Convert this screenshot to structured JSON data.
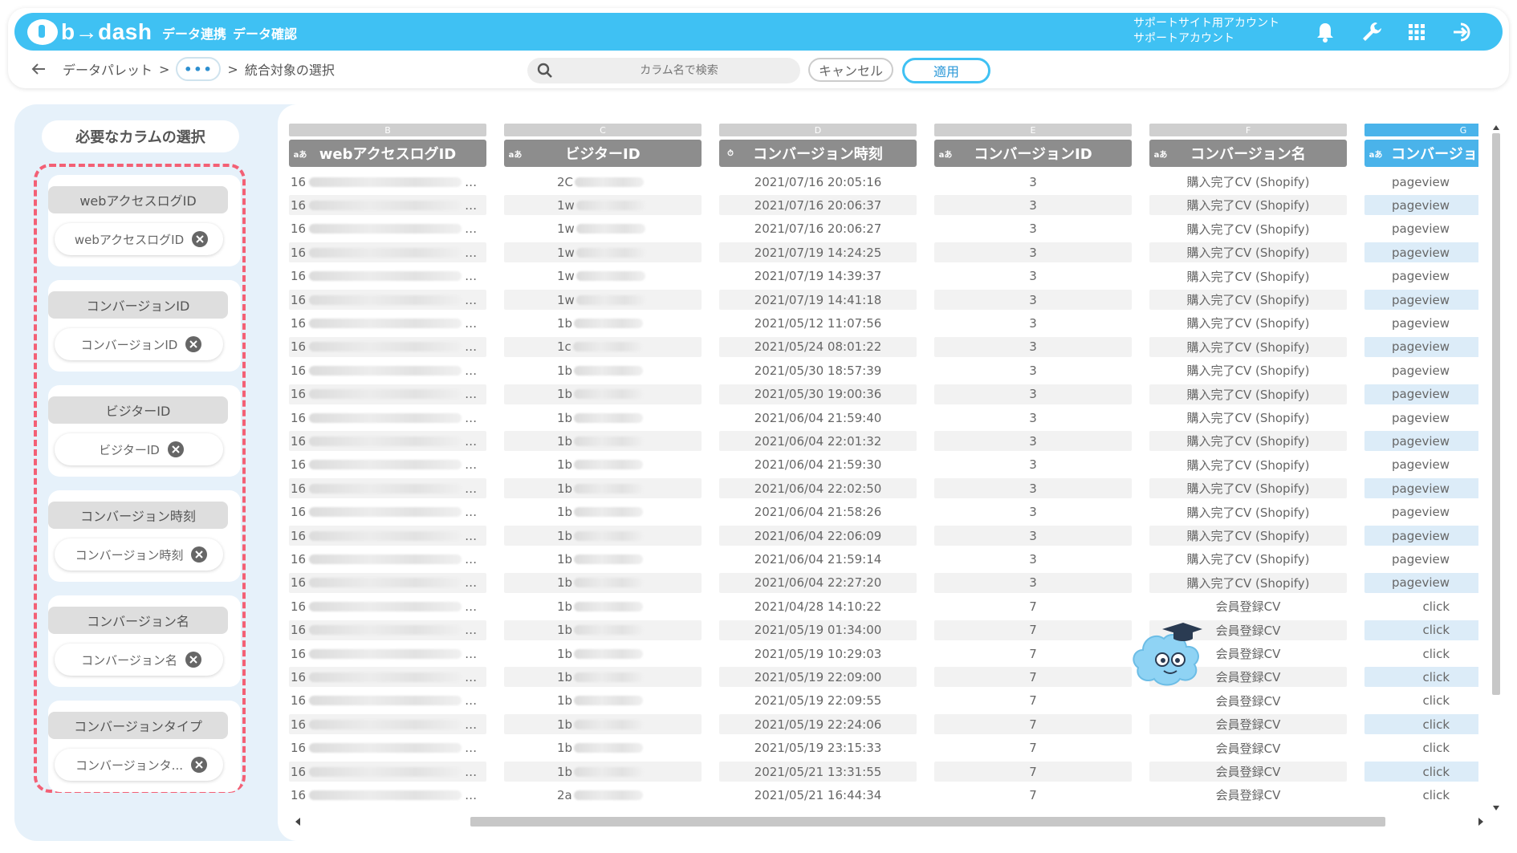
{
  "brand": {
    "logo_text": "b→dash"
  },
  "nav": [
    {
      "label": "データ連携"
    },
    {
      "label": "データ確認"
    }
  ],
  "account": {
    "line1": "サポートサイト用アカウント",
    "line2": "サポートアカウント"
  },
  "icons": {
    "bell": "bell-icon",
    "tools": "wrench-icon",
    "apps": "grid-icon",
    "logout": "logout-icon"
  },
  "breadcrumb": {
    "root": "データパレット",
    "sep": ">",
    "ellipsis": "•••",
    "current": "統合対象の選択"
  },
  "search": {
    "placeholder": "カラム名で検索",
    "value": ""
  },
  "actions": {
    "cancel": "キャンセル",
    "apply": "適用"
  },
  "colors": {
    "accent": "#3fc1f3",
    "dash": "#f36075",
    "header_gray": "#8d8d8d",
    "active_col": "#4ab3ea"
  },
  "sidebar": {
    "title": "必要なカラムの選択",
    "slots": [
      {
        "title": "webアクセスログID",
        "chip": "webアクセスログID"
      },
      {
        "title": "コンバージョンID",
        "chip": "コンバージョンID"
      },
      {
        "title": "ビジターID",
        "chip": "ビジターID"
      },
      {
        "title": "コンバージョン時刻",
        "chip": "コンバージョン時刻"
      },
      {
        "title": "コンバージョン名",
        "chip": "コンバージョン名"
      },
      {
        "title": "コンバージョンタイプ",
        "chip": "コンバージョンタ..."
      }
    ]
  },
  "table": {
    "columns": [
      {
        "letter": "B",
        "type": "aあ",
        "name": "webアクセスログID"
      },
      {
        "letter": "C",
        "type": "aあ",
        "name": "ビジターID"
      },
      {
        "letter": "D",
        "type": "⏱",
        "name": "コンバージョン時刻"
      },
      {
        "letter": "E",
        "type": "aあ",
        "name": "コンバージョンID"
      },
      {
        "letter": "F",
        "type": "aあ",
        "name": "コンバージョン名"
      },
      {
        "letter": "G",
        "type": "aあ",
        "name": "コンバージョンタイプ"
      }
    ],
    "rows": [
      {
        "b": "16",
        "c": "2C",
        "d": "2021/07/16 20:05:16",
        "e": "3",
        "f": "購入完了CV (Shopify)",
        "g": "pageview"
      },
      {
        "b": "16",
        "c": "1w",
        "d": "2021/07/16 20:06:37",
        "e": "3",
        "f": "購入完了CV (Shopify)",
        "g": "pageview"
      },
      {
        "b": "16",
        "c": "1w",
        "d": "2021/07/16 20:06:27",
        "e": "3",
        "f": "購入完了CV (Shopify)",
        "g": "pageview"
      },
      {
        "b": "16",
        "c": "1w",
        "d": "2021/07/19 14:24:25",
        "e": "3",
        "f": "購入完了CV (Shopify)",
        "g": "pageview"
      },
      {
        "b": "16",
        "c": "1w",
        "d": "2021/07/19 14:39:37",
        "e": "3",
        "f": "購入完了CV (Shopify)",
        "g": "pageview"
      },
      {
        "b": "16",
        "c": "1w",
        "d": "2021/07/19 14:41:18",
        "e": "3",
        "f": "購入完了CV (Shopify)",
        "g": "pageview"
      },
      {
        "b": "16",
        "c": "1b",
        "d": "2021/05/12 11:07:56",
        "e": "3",
        "f": "購入完了CV (Shopify)",
        "g": "pageview"
      },
      {
        "b": "16",
        "c": "1c",
        "d": "2021/05/24 08:01:22",
        "e": "3",
        "f": "購入完了CV (Shopify)",
        "g": "pageview"
      },
      {
        "b": "16",
        "c": "1b",
        "d": "2021/05/30 18:57:39",
        "e": "3",
        "f": "購入完了CV (Shopify)",
        "g": "pageview"
      },
      {
        "b": "16",
        "c": "1b",
        "d": "2021/05/30 19:00:36",
        "e": "3",
        "f": "購入完了CV (Shopify)",
        "g": "pageview"
      },
      {
        "b": "16",
        "c": "1b",
        "d": "2021/06/04 21:59:40",
        "e": "3",
        "f": "購入完了CV (Shopify)",
        "g": "pageview"
      },
      {
        "b": "16",
        "c": "1b",
        "d": "2021/06/04 22:01:32",
        "e": "3",
        "f": "購入完了CV (Shopify)",
        "g": "pageview"
      },
      {
        "b": "16",
        "c": "1b",
        "d": "2021/06/04 21:59:30",
        "e": "3",
        "f": "購入完了CV (Shopify)",
        "g": "pageview"
      },
      {
        "b": "16",
        "c": "1b",
        "d": "2021/06/04 22:02:50",
        "e": "3",
        "f": "購入完了CV (Shopify)",
        "g": "pageview"
      },
      {
        "b": "16",
        "c": "1b",
        "d": "2021/06/04 21:58:26",
        "e": "3",
        "f": "購入完了CV (Shopify)",
        "g": "pageview"
      },
      {
        "b": "16",
        "c": "1b",
        "d": "2021/06/04 22:06:09",
        "e": "3",
        "f": "購入完了CV (Shopify)",
        "g": "pageview"
      },
      {
        "b": "16",
        "c": "1b",
        "d": "2021/06/04 21:59:14",
        "e": "3",
        "f": "購入完了CV (Shopify)",
        "g": "pageview"
      },
      {
        "b": "16",
        "c": "1b",
        "d": "2021/06/04 22:27:20",
        "e": "3",
        "f": "購入完了CV (Shopify)",
        "g": "pageview"
      },
      {
        "b": "16",
        "c": "1b",
        "d": "2021/04/28 14:10:22",
        "e": "7",
        "f": "会員登録CV",
        "g": "click"
      },
      {
        "b": "16",
        "c": "1b",
        "d": "2021/05/19 01:34:00",
        "e": "7",
        "f": "会員登録CV",
        "g": "click"
      },
      {
        "b": "16",
        "c": "1b",
        "d": "2021/05/19 10:29:03",
        "e": "7",
        "f": "会員登録CV",
        "g": "click"
      },
      {
        "b": "16",
        "c": "1b",
        "d": "2021/05/19 22:09:00",
        "e": "7",
        "f": "会員登録CV",
        "g": "click"
      },
      {
        "b": "16",
        "c": "1b",
        "d": "2021/05/19 22:09:55",
        "e": "7",
        "f": "会員登録CV",
        "g": "click"
      },
      {
        "b": "16",
        "c": "1b",
        "d": "2021/05/19 22:24:06",
        "e": "7",
        "f": "会員登録CV",
        "g": "click"
      },
      {
        "b": "16",
        "c": "1b",
        "d": "2021/05/19 23:15:33",
        "e": "7",
        "f": "会員登録CV",
        "g": "click"
      },
      {
        "b": "16",
        "c": "1b",
        "d": "2021/05/21 13:31:55",
        "e": "7",
        "f": "会員登録CV",
        "g": "click"
      },
      {
        "b": "16",
        "c": "2a",
        "d": "2021/05/21 16:44:34",
        "e": "7",
        "f": "会員登録CV",
        "g": "click"
      }
    ]
  }
}
